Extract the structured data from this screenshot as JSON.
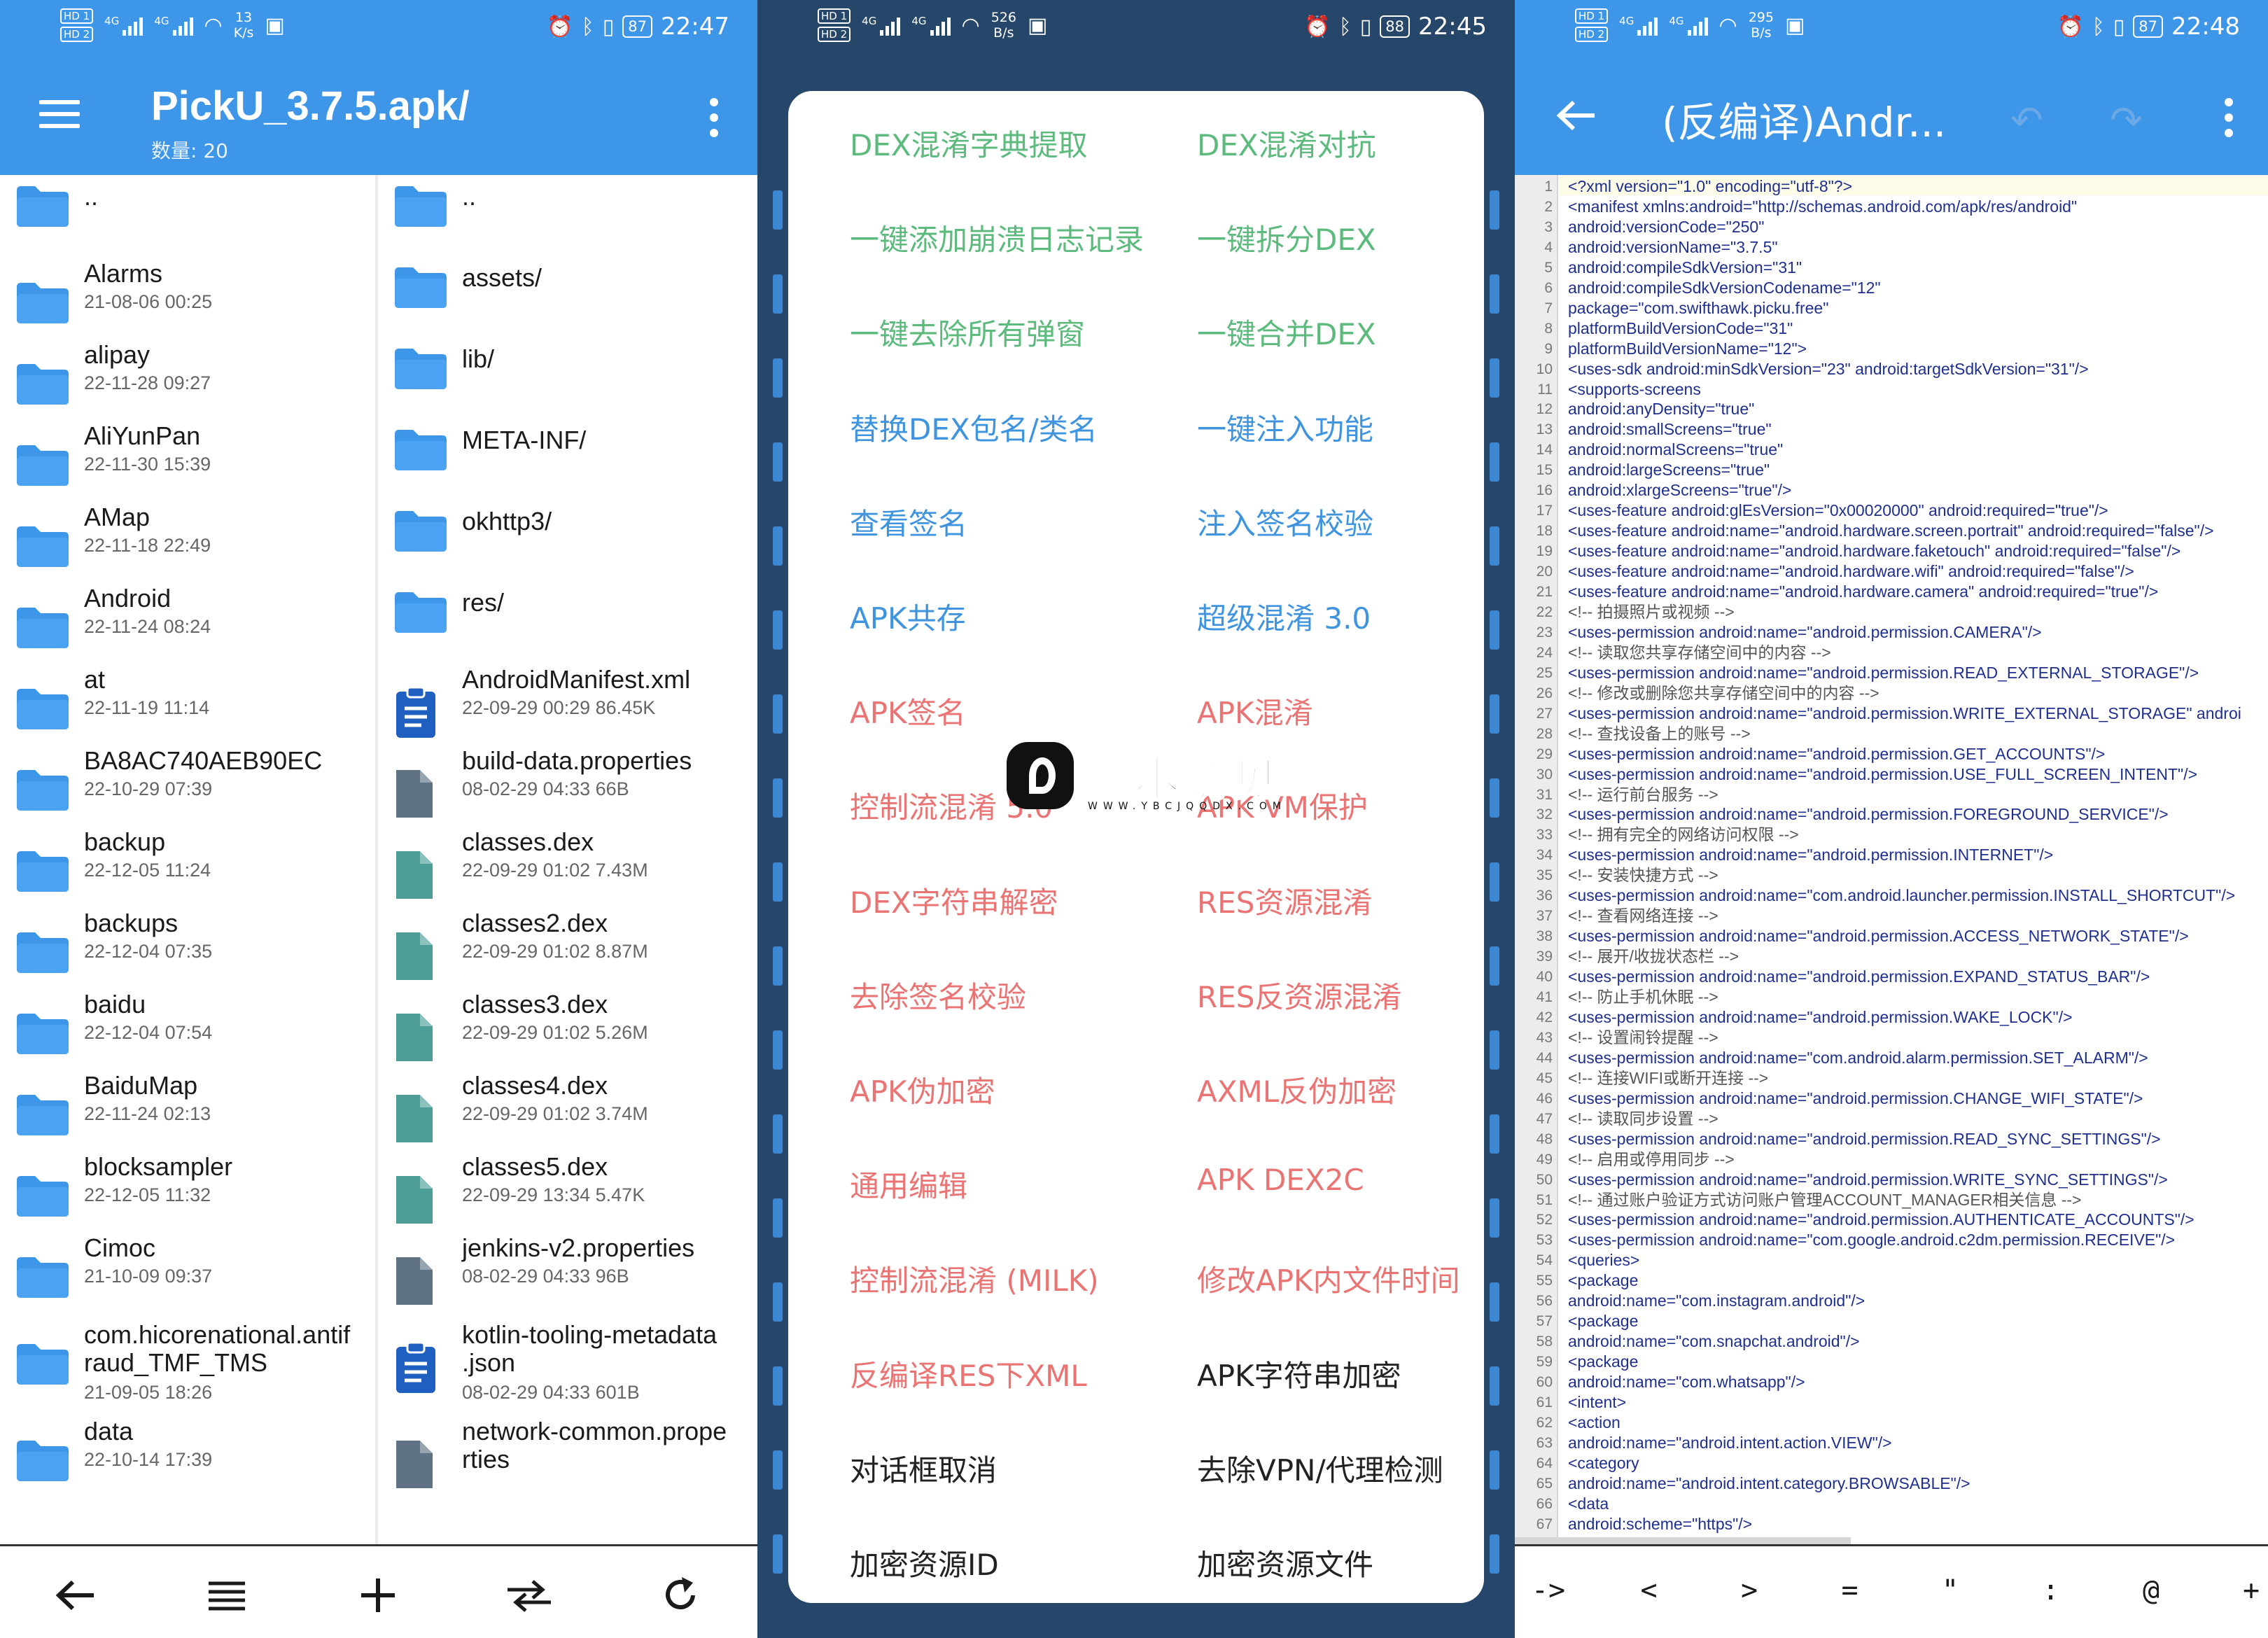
{
  "panel1": {
    "status": {
      "speed_value": "13",
      "speed_unit": "K/s",
      "battery": "87",
      "time": "22:47"
    },
    "header": {
      "title": "PickU_3.7.5.apk/",
      "subtitle": "数量: 20"
    },
    "left_list": [
      {
        "name": "..",
        "meta": "",
        "type": "folder"
      },
      {
        "name": "Alarms",
        "meta": "21-08-06 00:25",
        "type": "folder"
      },
      {
        "name": "alipay",
        "meta": "22-11-28 09:27",
        "type": "folder"
      },
      {
        "name": "AliYunPan",
        "meta": "22-11-30 15:39",
        "type": "folder"
      },
      {
        "name": "AMap",
        "meta": "22-11-18 22:49",
        "type": "folder"
      },
      {
        "name": "Android",
        "meta": "22-11-24 08:24",
        "type": "folder"
      },
      {
        "name": "at",
        "meta": "22-11-19 11:14",
        "type": "folder"
      },
      {
        "name": "BA8AC740AEB90EC",
        "meta": "22-10-29 07:39",
        "type": "folder"
      },
      {
        "name": "backup",
        "meta": "22-12-05 11:24",
        "type": "folder"
      },
      {
        "name": "backups",
        "meta": "22-12-04 07:35",
        "type": "folder"
      },
      {
        "name": "baidu",
        "meta": "22-12-04 07:54",
        "type": "folder"
      },
      {
        "name": "BaiduMap",
        "meta": "22-11-24 02:13",
        "type": "folder"
      },
      {
        "name": "blocksampler",
        "meta": "22-12-05 11:32",
        "type": "folder"
      },
      {
        "name": "Cimoc",
        "meta": "21-10-09 09:37",
        "type": "folder"
      },
      {
        "name": "com.hicorenational.antif",
        "name2": "raud_TMF_TMS",
        "meta": "21-09-05 18:26",
        "type": "folder"
      },
      {
        "name": "data",
        "meta": "22-10-14 17:39",
        "type": "folder"
      }
    ],
    "right_list": [
      {
        "name": "..",
        "meta": "",
        "type": "folder"
      },
      {
        "name": "assets/",
        "meta": "",
        "type": "folder"
      },
      {
        "name": "lib/",
        "meta": "",
        "type": "folder"
      },
      {
        "name": "META-INF/",
        "meta": "",
        "type": "folder"
      },
      {
        "name": "okhttp3/",
        "meta": "",
        "type": "folder"
      },
      {
        "name": "res/",
        "meta": "",
        "type": "folder"
      },
      {
        "name": "AndroidManifest.xml",
        "meta": "22-09-29 00:29  86.45K",
        "type": "doc"
      },
      {
        "name": "build-data.properties",
        "meta": "08-02-29 04:33  66B",
        "type": "file-gray"
      },
      {
        "name": "classes.dex",
        "meta": "22-09-29 01:02  7.43M",
        "type": "file-teal"
      },
      {
        "name": "classes2.dex",
        "meta": "22-09-29 01:02  8.87M",
        "type": "file-teal"
      },
      {
        "name": "classes3.dex",
        "meta": "22-09-29 01:02  5.26M",
        "type": "file-teal"
      },
      {
        "name": "classes4.dex",
        "meta": "22-09-29 01:02  3.74M",
        "type": "file-teal"
      },
      {
        "name": "classes5.dex",
        "meta": "22-09-29 13:34  5.47K",
        "type": "file-teal"
      },
      {
        "name": "jenkins-v2.properties",
        "meta": "08-02-29 04:33  96B",
        "type": "file-gray"
      },
      {
        "name": "kotlin-tooling-metadata",
        "name2": ".json",
        "meta": "08-02-29 04:33  601B",
        "type": "doc"
      },
      {
        "name": "network-common.prope",
        "name2": "rties",
        "meta": "",
        "type": "file-gray"
      }
    ],
    "bottom_icons": [
      "back-arrow-icon",
      "list-icon",
      "plus-icon",
      "swap-icon",
      "refresh-icon"
    ]
  },
  "panel2": {
    "status": {
      "speed_value": "526",
      "speed_unit": "B/s",
      "battery": "88",
      "time": "22:45"
    },
    "menu": [
      {
        "left": "DEX混淆字典提取",
        "left_color": "green",
        "right": "DEX混淆对抗",
        "right_color": "green"
      },
      {
        "left": "一键添加崩溃日志记录",
        "left_color": "green",
        "right": "一键拆分DEX",
        "right_color": "green"
      },
      {
        "left": "一键去除所有弹窗",
        "left_color": "green",
        "right": "一键合并DEX",
        "right_color": "green"
      },
      {
        "left": "替换DEX包名/类名",
        "left_color": "blue",
        "right": "一键注入功能",
        "right_color": "blue"
      },
      {
        "left": "查看签名",
        "left_color": "blue",
        "right": "注入签名校验",
        "right_color": "blue"
      },
      {
        "left": "APK共存",
        "left_color": "blue",
        "right": "超级混淆 3.0",
        "right_color": "blue"
      },
      {
        "left": "APK签名",
        "left_color": "red",
        "right": "APK混淆",
        "right_color": "red"
      },
      {
        "left": "控制流混淆 5.0",
        "left_color": "red",
        "right": "APK VM保护",
        "right_color": "red"
      },
      {
        "left": "DEX字符串解密",
        "left_color": "red",
        "right": "RES资源混淆",
        "right_color": "red"
      },
      {
        "left": "去除签名校验",
        "left_color": "red",
        "right": "RES反资源混淆",
        "right_color": "red"
      },
      {
        "left": "APK伪加密",
        "left_color": "red",
        "right": "AXML反伪加密",
        "right_color": "red"
      },
      {
        "left": "通用编辑",
        "left_color": "red",
        "right": "APK DEX2C",
        "right_color": "red"
      },
      {
        "left": "控制流混淆 (MILK)",
        "left_color": "red",
        "right": "修改APK内文件时间",
        "right_color": "red"
      },
      {
        "left": "反编译RES下XML",
        "left_color": "red",
        "right": "APK字符串加密",
        "right_color": "black"
      },
      {
        "left": "对话框取消",
        "left_color": "black",
        "right": "去除VPN/代理检测",
        "right_color": "black"
      },
      {
        "left": "加密资源ID",
        "left_color": "black",
        "right": "加密资源文件",
        "right_color": "black"
      }
    ],
    "watermark": {
      "text": "缘本初见",
      "url": "WWW.YBCJQQDX.COM"
    }
  },
  "panel3": {
    "status": {
      "speed_value": "295",
      "speed_unit": "B/s",
      "battery": "87",
      "time": "22:48"
    },
    "header": {
      "title": "(反编译)Andr..."
    },
    "code": [
      "<?xml version=\"1.0\" encoding=\"utf-8\"?>",
      "<manifest xmlns:android=\"http://schemas.android.com/apk/res/android\"",
      "    android:versionCode=\"250\"",
      "    android:versionName=\"3.7.5\"",
      "    android:compileSdkVersion=\"31\"",
      "    android:compileSdkVersionCodename=\"12\"",
      "    package=\"com.swifthawk.picku.free\"",
      "    platformBuildVersionCode=\"31\"",
      "    platformBuildVersionName=\"12\">",
      "  <uses-sdk android:minSdkVersion=\"23\" android:targetSdkVersion=\"31\"/>",
      "  <supports-screens",
      "      android:anyDensity=\"true\"",
      "      android:smallScreens=\"true\"",
      "      android:normalScreens=\"true\"",
      "      android:largeScreens=\"true\"",
      "      android:xlargeScreens=\"true\"/>",
      "  <uses-feature android:glEsVersion=\"0x00020000\" android:required=\"true\"/>",
      "  <uses-feature android:name=\"android.hardware.screen.portrait\" android:required=\"false\"/>",
      "  <uses-feature android:name=\"android.hardware.faketouch\" android:required=\"false\"/>",
      "  <uses-feature android:name=\"android.hardware.wifi\" android:required=\"false\"/>",
      "  <uses-feature android:name=\"android.hardware.camera\" android:required=\"true\"/>",
      "  <!-- 拍摄照片或视频 -->",
      "  <uses-permission android:name=\"android.permission.CAMERA\"/>",
      "  <!-- 读取您共享存储空间中的内容 -->",
      "  <uses-permission android:name=\"android.permission.READ_EXTERNAL_STORAGE\"/>",
      "  <!-- 修改或删除您共享存储空间中的内容 -->",
      "  <uses-permission android:name=\"android.permission.WRITE_EXTERNAL_STORAGE\" androi",
      "  <!-- 查找设备上的账号 -->",
      "  <uses-permission android:name=\"android.permission.GET_ACCOUNTS\"/>",
      "  <uses-permission android:name=\"android.permission.USE_FULL_SCREEN_INTENT\"/>",
      "  <!-- 运行前台服务 -->",
      "  <uses-permission android:name=\"android.permission.FOREGROUND_SERVICE\"/>",
      "  <!-- 拥有完全的网络访问权限 -->",
      "  <uses-permission android:name=\"android.permission.INTERNET\"/>",
      "  <!-- 安装快捷方式 -->",
      "  <uses-permission android:name=\"com.android.launcher.permission.INSTALL_SHORTCUT\"/>",
      "  <!-- 查看网络连接 -->",
      "  <uses-permission android:name=\"android.permission.ACCESS_NETWORK_STATE\"/>",
      "  <!-- 展开/收拢状态栏 -->",
      "  <uses-permission android:name=\"android.permission.EXPAND_STATUS_BAR\"/>",
      "  <!-- 防止手机休眠 -->",
      "  <uses-permission android:name=\"android.permission.WAKE_LOCK\"/>",
      "  <!-- 设置闹铃提醒 -->",
      "  <uses-permission android:name=\"com.android.alarm.permission.SET_ALARM\"/>",
      "  <!-- 连接WIFI或断开连接 -->",
      "  <uses-permission android:name=\"android.permission.CHANGE_WIFI_STATE\"/>",
      "  <!-- 读取同步设置 -->",
      "  <uses-permission android:name=\"android.permission.READ_SYNC_SETTINGS\"/>",
      "  <!-- 启用或停用同步 -->",
      "  <uses-permission android:name=\"android.permission.WRITE_SYNC_SETTINGS\"/>",
      "  <!-- 通过账户验证方式访问账户管理ACCOUNT_MANAGER相关信息 -->",
      "  <uses-permission android:name=\"android.permission.AUTHENTICATE_ACCOUNTS\"/>",
      "  <uses-permission android:name=\"com.google.android.c2dm.permission.RECEIVE\"/>",
      "  <queries>",
      "    <package",
      "        android:name=\"com.instagram.android\"/>",
      "    <package",
      "        android:name=\"com.snapchat.android\"/>",
      "    <package",
      "        android:name=\"com.whatsapp\"/>",
      "    <intent>",
      "      <action",
      "          android:name=\"android.intent.action.VIEW\"/>",
      "      <category",
      "          android:name=\"android.intent.category.BROWSABLE\"/>",
      "      <data",
      "          android:scheme=\"https\"/>"
    ],
    "symbols": [
      "->",
      "<",
      ">",
      "=",
      "\"",
      ":",
      "@",
      "+"
    ]
  },
  "colors": {
    "appbar": "#3d96e8",
    "folder": "#3d96e8",
    "menu_green": "#5cba7d",
    "menu_blue": "#3f94e0",
    "menu_red": "#ea7373",
    "code_text": "#1f2f8f"
  }
}
